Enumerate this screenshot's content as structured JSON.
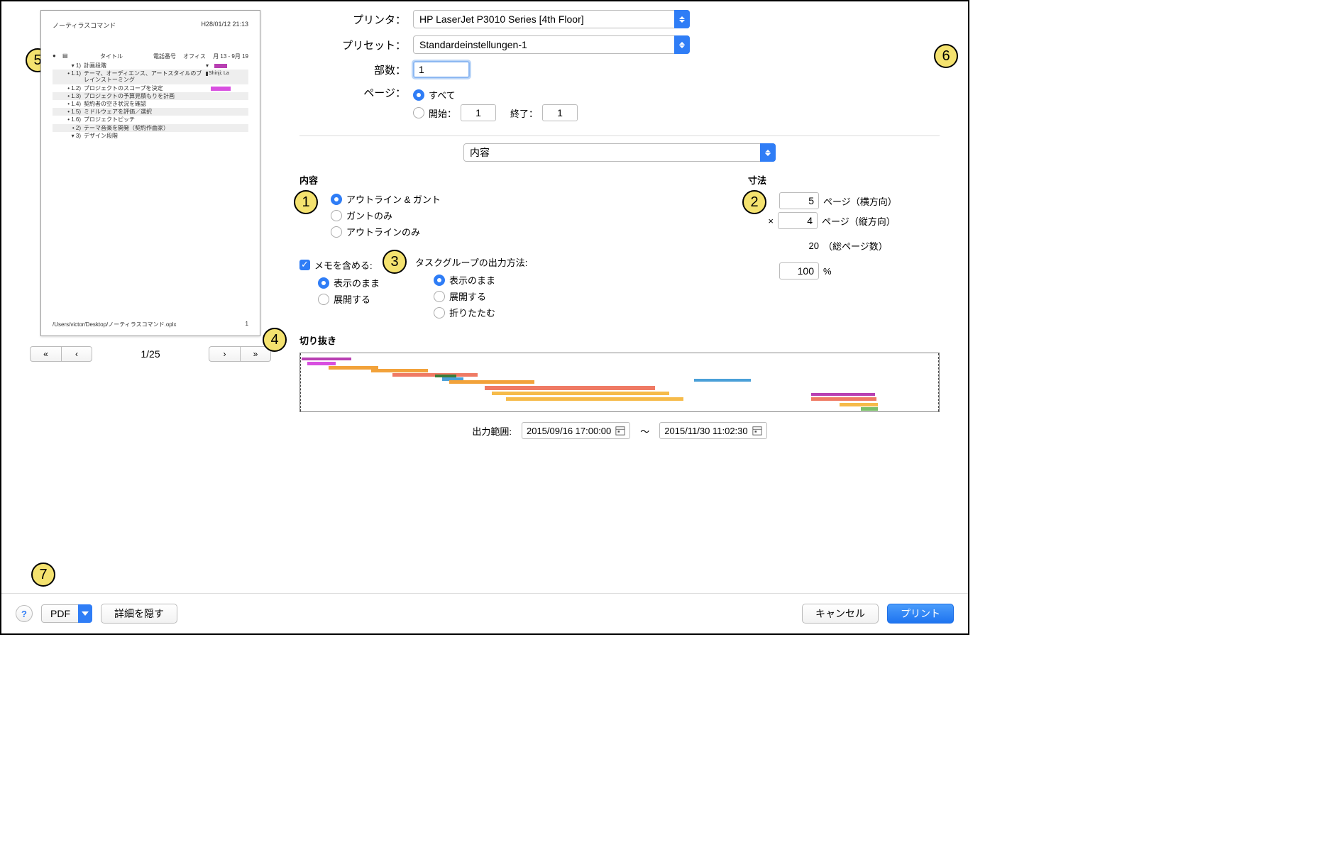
{
  "labels": {
    "printer": "プリンタ：",
    "preset": "プリセット：",
    "copies": "部数：",
    "pages": "ページ：",
    "all": "すべて",
    "from": "開始：",
    "to": "終了：",
    "panel_select": "内容",
    "content_hdr": "内容",
    "dim_hdr": "寸法",
    "opt_outline_gantt": "アウトライン & ガント",
    "opt_gantt_only": "ガントのみ",
    "opt_outline_only": "アウトラインのみ",
    "include_notes": "メモを含める:",
    "as_shown": "表示のまま",
    "expand": "展開する",
    "collapse": "折りたたむ",
    "task_group_output": "タスクグループの出力方法:",
    "pages_wide": "ページ（横方向）",
    "pages_tall": "ページ（縦方向）",
    "total_pages": "（総ページ数）",
    "percent": "%",
    "crop_hdr": "切り抜き",
    "output_range": "出力範囲:",
    "tilde": "〜",
    "mult": "×",
    "pdf": "PDF",
    "hide_details": "詳細を隠す",
    "cancel": "キャンセル",
    "print": "プリント"
  },
  "values": {
    "printer": "HP LaserJet P3010 Series [4th Floor]",
    "preset": "Standardeinstellungen-1",
    "copies": "1",
    "page_from": "1",
    "page_to": "1",
    "pages_wide": "5",
    "pages_tall": "4",
    "total_pages": "20",
    "scale": "100",
    "date_start": "2015/09/16 17:00:00",
    "date_end": "2015/11/30 11:02:30",
    "page_indicator": "1/25"
  },
  "preview": {
    "doc_title": "ノーティラスコマンド",
    "timestamp": "H28/01/12 21:13",
    "cols": {
      "c3": "タイトル",
      "c4": "電話番号",
      "c5": "オフィス",
      "c6": "月 13 - 9月 19"
    },
    "footer_path": "/Users/victor/Desktop/ノーティラスコマンド.oplx",
    "footer_page": "1",
    "rows": [
      {
        "num": "▾ 1)",
        "txt": "計画段階",
        "alt": false,
        "bar": {
          "l": 70,
          "w": 18,
          "c": "#b83fb2"
        },
        "arrow": true
      },
      {
        "num": "• 1.1)",
        "txt": "テーマ、オーディエンス、アートスタイルのブレインストーミング",
        "alt": true,
        "bar": {
          "l": 58,
          "w": 3,
          "c": "#333"
        },
        "lbl": "Shinji; La"
      },
      {
        "num": "• 1.2)",
        "txt": "プロジェクトのスコープを決定",
        "alt": false,
        "bar": {
          "l": 65,
          "w": 28,
          "c": "#d84fe0"
        }
      },
      {
        "num": "• 1.3)",
        "txt": "プロジェクトの予算見積もりを計画",
        "alt": true
      },
      {
        "num": "• 1.4)",
        "txt": "契約者の空き状況を確認",
        "alt": false
      },
      {
        "num": "• 1.5)",
        "txt": "ミドルウェアを評価／選択",
        "alt": true
      },
      {
        "num": "• 1.6)",
        "txt": "プロジェクトピッチ",
        "alt": false
      },
      {
        "num": "• 2)",
        "txt": "テーマ音楽を開発（契約作曲家）",
        "alt": true
      },
      {
        "num": "▾ 3)",
        "txt": "デザイン段階",
        "alt": false
      }
    ]
  },
  "badges": {
    "b1": "1",
    "b2": "2",
    "b3": "3",
    "b4": "4",
    "b5": "5",
    "b6": "6",
    "b7": "7"
  }
}
